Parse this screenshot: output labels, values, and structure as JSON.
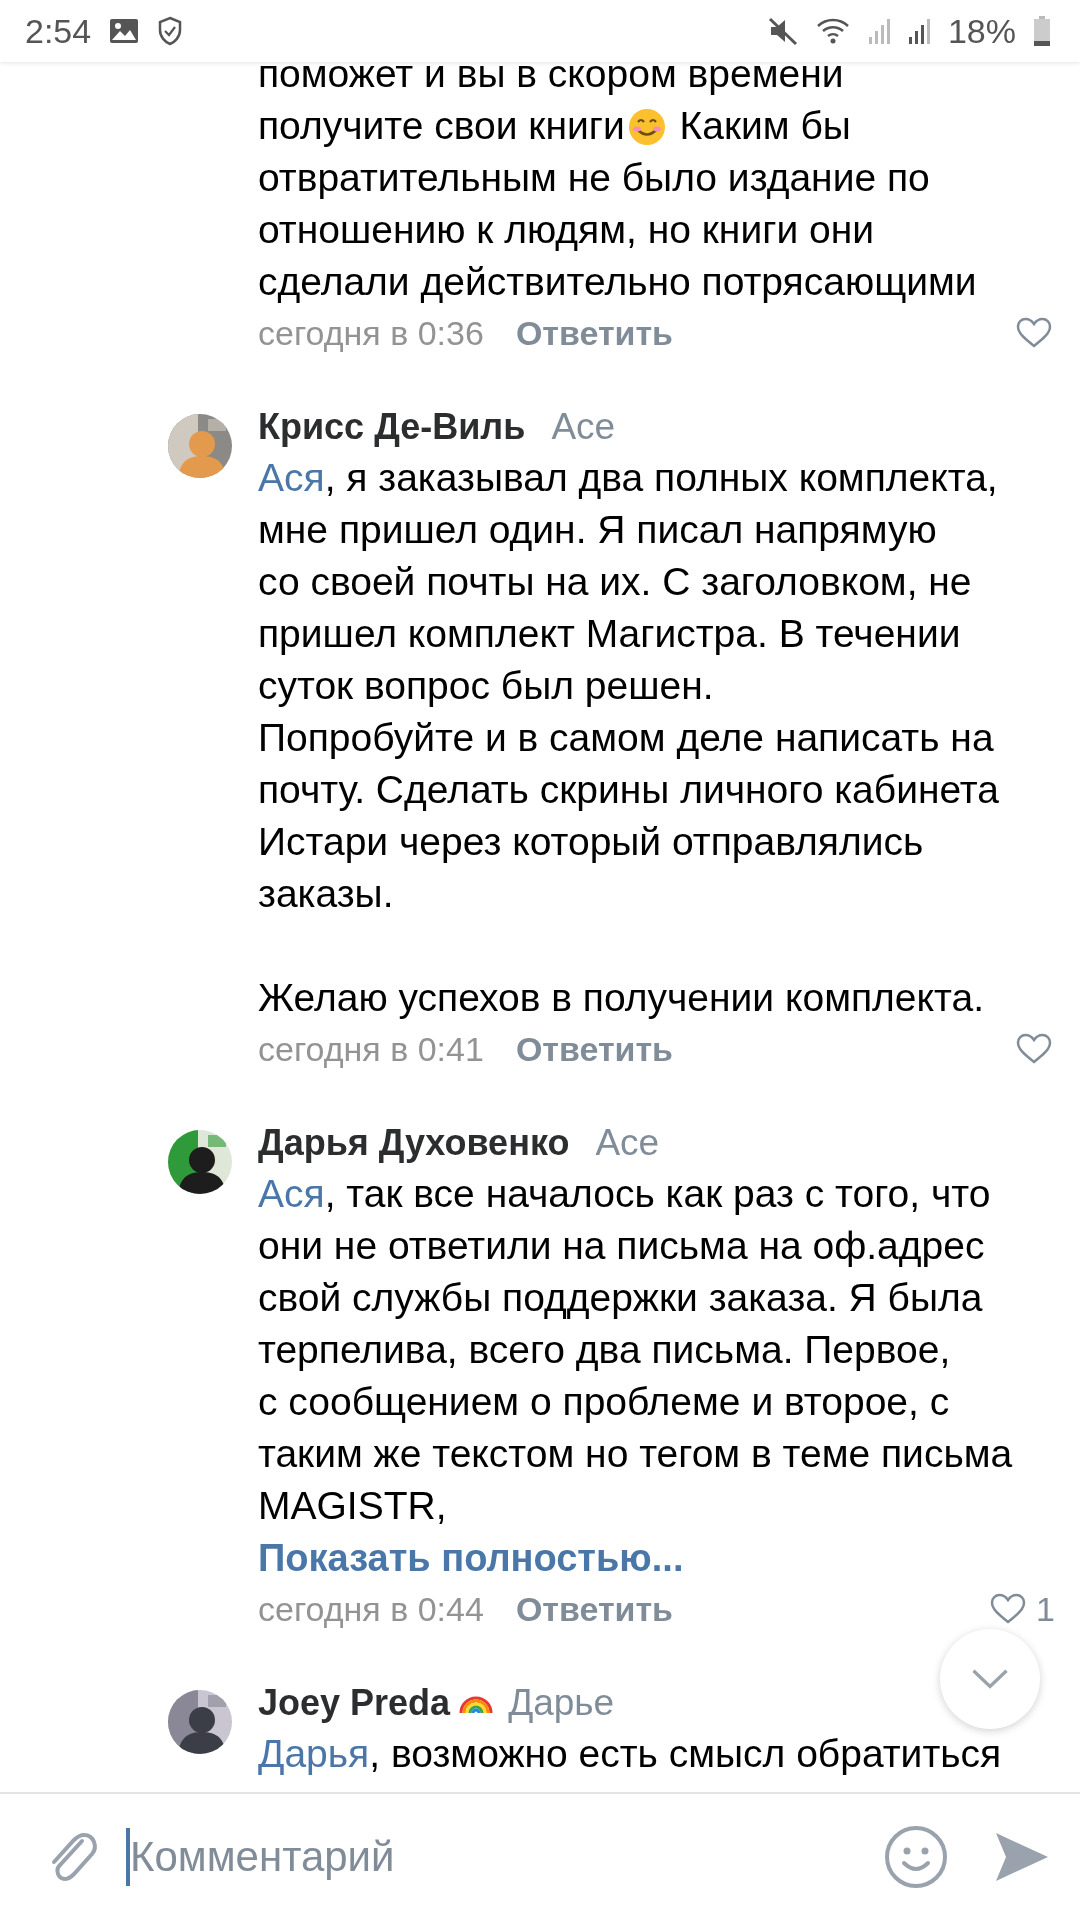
{
  "status_bar": {
    "time": "2:54",
    "battery": "18%"
  },
  "comments": [
    {
      "body": [
        {
          "kind": "text",
          "text": "поможет и вы в скором времени\nполучите свои книги"
        },
        {
          "kind": "emoji"
        },
        {
          "kind": "text",
          "text": " Каким бы\nотвратительным не было издание по\nотношению к людям, но книги они\nсделали действительно потрясающими"
        }
      ],
      "time": "сегодня в 0:36",
      "reply": "Ответить"
    },
    {
      "author": "Крисс Де-Виль",
      "reply_to": "Асе",
      "avatar": {
        "kind": "picture"
      },
      "body": [
        {
          "kind": "mention",
          "text": "Ася"
        },
        {
          "kind": "text",
          "text": ", я заказывал два полных комплекта,\nмне пришел один. Я писал напрямую\nсо своей почты на их. С заголовком, не\nпришел комплект Магистра. В течении\nсуток вопрос был решен.\nПопробуйте и в самом деле написать на\nпочту. Сделать скрины личного кабинета\nИстари через который отправлялись\nзаказы.\n\nЖелаю успехов в получении комплекта."
        }
      ],
      "time": "сегодня в 0:41",
      "reply": "Ответить"
    },
    {
      "author": "Дарья Духовенко",
      "reply_to": "Асе",
      "avatar": {
        "kind": "picture"
      },
      "body": [
        {
          "kind": "mention",
          "text": "Ася"
        },
        {
          "kind": "text",
          "text": ", так все началось как раз с того, что\nони не ответили на письма на оф.адрес\nсвой службы поддержки заказа. Я была\nтерпелива, всего два письма. Первое,\nс сообщением о проблеме и второе, с\nтаким же текстом но тегом в теме письма\nMAGISTR,"
        }
      ],
      "show_more": "Показать полностью...",
      "time": "сегодня в 0:44",
      "reply": "Ответить",
      "likes": "1"
    },
    {
      "author": "Joey Preda",
      "badge": {
        "kind": "rainbow"
      },
      "reply_to": "Дарье",
      "avatar": {
        "kind": "picture"
      },
      "body": [
        {
          "kind": "mention",
          "text": "Дарья"
        },
        {
          "kind": "text",
          "text": ", возможно есть смысл обратиться"
        }
      ]
    }
  ],
  "composer": {
    "placeholder": "Комментарий"
  }
}
